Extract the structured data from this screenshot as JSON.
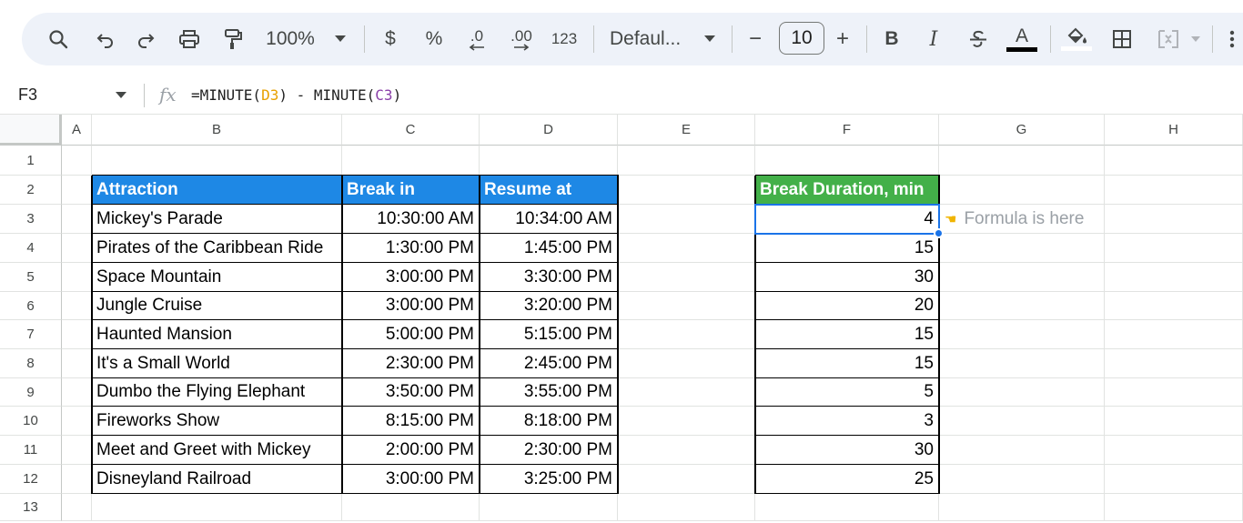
{
  "toolbar": {
    "zoom": "100%",
    "currency": "$",
    "percent": "%",
    "decrease_decimal": ".0",
    "increase_decimal": ".00",
    "number_format": "123",
    "font_family": "Defaul...",
    "font_size": "10",
    "minus": "−",
    "plus": "+",
    "bold": "B",
    "italic": "I",
    "text_color": "A"
  },
  "formula_bar": {
    "name_box": "F3",
    "fx": "fx",
    "formula_prefix": "=MINUTE(",
    "formula_ref1": "D3",
    "formula_mid": ") - MINUTE(",
    "formula_ref2": "C3",
    "formula_suffix": ")"
  },
  "columns": [
    "A",
    "B",
    "C",
    "D",
    "E",
    "F",
    "G",
    "H"
  ],
  "rows": [
    "1",
    "2",
    "3",
    "4",
    "5",
    "6",
    "7",
    "8",
    "9",
    "10",
    "11",
    "12",
    "13"
  ],
  "table": {
    "headers": {
      "attraction": "Attraction",
      "break_in": "Break in",
      "resume_at": "Resume at",
      "duration": "Break Duration, min"
    },
    "data": [
      {
        "attraction": "Mickey's Parade",
        "break_in": "10:30:00 AM",
        "resume_at": "10:34:00 AM",
        "duration": "4"
      },
      {
        "attraction": "Pirates of the Caribbean Ride",
        "break_in": "1:30:00 PM",
        "resume_at": "1:45:00 PM",
        "duration": "15"
      },
      {
        "attraction": "Space Mountain",
        "break_in": "3:00:00 PM",
        "resume_at": "3:30:00 PM",
        "duration": "30"
      },
      {
        "attraction": "Jungle Cruise",
        "break_in": "3:00:00 PM",
        "resume_at": "3:20:00 PM",
        "duration": "20"
      },
      {
        "attraction": "Haunted Mansion",
        "break_in": "5:00:00 PM",
        "resume_at": "5:15:00 PM",
        "duration": "15"
      },
      {
        "attraction": "It's a Small World",
        "break_in": "2:30:00 PM",
        "resume_at": "2:45:00 PM",
        "duration": "15"
      },
      {
        "attraction": "Dumbo the Flying Elephant",
        "break_in": "3:50:00 PM",
        "resume_at": "3:55:00 PM",
        "duration": "5"
      },
      {
        "attraction": "Fireworks Show",
        "break_in": "8:15:00 PM",
        "resume_at": "8:18:00 PM",
        "duration": "3"
      },
      {
        "attraction": "Meet and Greet with Mickey",
        "break_in": "2:00:00 PM",
        "resume_at": "2:30:00 PM",
        "duration": "30"
      },
      {
        "attraction": "Disneyland Railroad",
        "break_in": "3:00:00 PM",
        "resume_at": "3:25:00 PM",
        "duration": "25"
      }
    ]
  },
  "annotation": {
    "text": "Formula is here",
    "icon": "pointing-hand-icon"
  },
  "colors": {
    "header_blue": "#1e88e5",
    "header_green": "#43b049",
    "selection": "#1a73e8",
    "toolbar_bg": "#eef2f9"
  }
}
